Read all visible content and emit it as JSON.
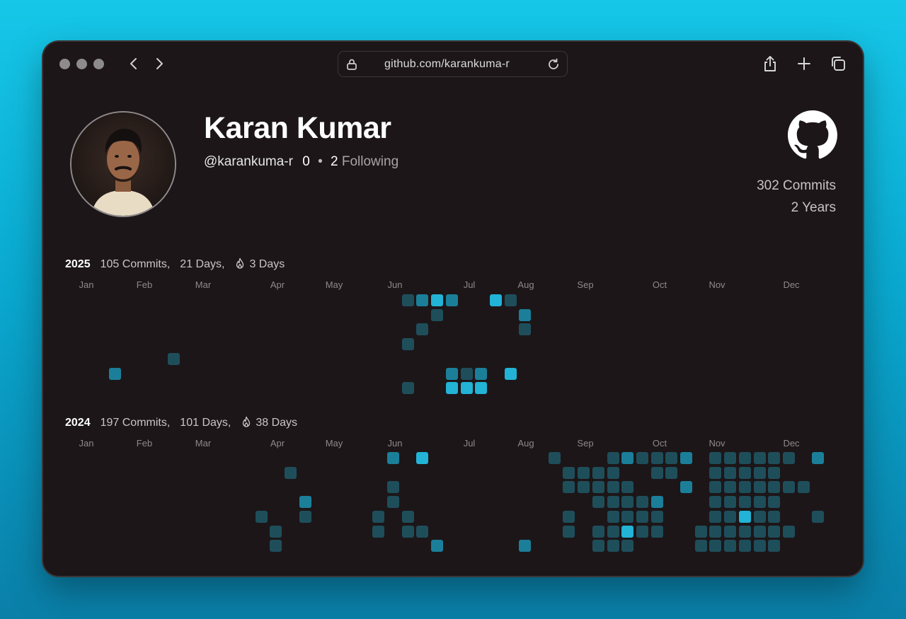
{
  "browser": {
    "url": "github.com/karankuma-r"
  },
  "profile": {
    "name": "Karan Kumar",
    "handle": "@karankuma-r",
    "followers": "0",
    "following_count": "2",
    "following_label": "Following",
    "total_commits": "302 Commits",
    "years": "2 Years"
  },
  "colors": {
    "background_top": "#16c7e8",
    "window": "#1c1618",
    "cell_low": "#1f4e5b",
    "cell_mid": "#1b7f9a",
    "cell_high": "#22b3d6"
  },
  "months": [
    "Jan",
    "Feb",
    "Mar",
    "Apr",
    "May",
    "Jun",
    "Jul",
    "Aug",
    "Sep",
    "Oct",
    "Nov",
    "Dec"
  ],
  "years": [
    {
      "year": "2025",
      "commits": "105 Commits,",
      "days": "21 Days,",
      "streak": "3 Days",
      "cells": [
        [
          21,
          0,
          1
        ],
        [
          22,
          0,
          2
        ],
        [
          23,
          0,
          3
        ],
        [
          24,
          0,
          2
        ],
        [
          27,
          0,
          3
        ],
        [
          28,
          0,
          1
        ],
        [
          23,
          1,
          1
        ],
        [
          29,
          1,
          2
        ],
        [
          22,
          2,
          1
        ],
        [
          29,
          2,
          1
        ],
        [
          21,
          3,
          1
        ],
        [
          5,
          4,
          1
        ],
        [
          1,
          5,
          2
        ],
        [
          24,
          5,
          2
        ],
        [
          25,
          5,
          1
        ],
        [
          26,
          5,
          2
        ],
        [
          28,
          5,
          3
        ],
        [
          21,
          6,
          1
        ],
        [
          24,
          6,
          3
        ],
        [
          25,
          6,
          3
        ],
        [
          26,
          6,
          3
        ]
      ]
    },
    {
      "year": "2024",
      "commits": "197 Commits,",
      "days": "101 Days,",
      "streak": "38 Days",
      "cells": [
        [
          20,
          0,
          2
        ],
        [
          22,
          0,
          3
        ],
        [
          31,
          0,
          1
        ],
        [
          35,
          0,
          1
        ],
        [
          36,
          0,
          2
        ],
        [
          37,
          0,
          1
        ],
        [
          38,
          0,
          1
        ],
        [
          39,
          0,
          1
        ],
        [
          40,
          0,
          2
        ],
        [
          42,
          0,
          1
        ],
        [
          43,
          0,
          1
        ],
        [
          44,
          0,
          1
        ],
        [
          45,
          0,
          1
        ],
        [
          46,
          0,
          1
        ],
        [
          47,
          0,
          1
        ],
        [
          49,
          0,
          2
        ],
        [
          13,
          1,
          1
        ],
        [
          32,
          1,
          1
        ],
        [
          33,
          1,
          1
        ],
        [
          34,
          1,
          1
        ],
        [
          35,
          1,
          1
        ],
        [
          38,
          1,
          1
        ],
        [
          39,
          1,
          1
        ],
        [
          42,
          1,
          1
        ],
        [
          43,
          1,
          1
        ],
        [
          44,
          1,
          1
        ],
        [
          45,
          1,
          1
        ],
        [
          46,
          1,
          1
        ],
        [
          20,
          2,
          1
        ],
        [
          32,
          2,
          1
        ],
        [
          33,
          2,
          1
        ],
        [
          34,
          2,
          1
        ],
        [
          35,
          2,
          1
        ],
        [
          36,
          2,
          1
        ],
        [
          40,
          2,
          2
        ],
        [
          42,
          2,
          1
        ],
        [
          43,
          2,
          1
        ],
        [
          44,
          2,
          1
        ],
        [
          45,
          2,
          1
        ],
        [
          46,
          2,
          1
        ],
        [
          47,
          2,
          1
        ],
        [
          48,
          2,
          1
        ],
        [
          14,
          3,
          2
        ],
        [
          20,
          3,
          1
        ],
        [
          34,
          3,
          1
        ],
        [
          35,
          3,
          1
        ],
        [
          36,
          3,
          1
        ],
        [
          37,
          3,
          1
        ],
        [
          38,
          3,
          2
        ],
        [
          42,
          3,
          1
        ],
        [
          43,
          3,
          1
        ],
        [
          44,
          3,
          1
        ],
        [
          45,
          3,
          1
        ],
        [
          46,
          3,
          1
        ],
        [
          11,
          4,
          1
        ],
        [
          14,
          4,
          1
        ],
        [
          19,
          4,
          1
        ],
        [
          21,
          4,
          1
        ],
        [
          32,
          4,
          1
        ],
        [
          35,
          4,
          1
        ],
        [
          36,
          4,
          1
        ],
        [
          37,
          4,
          1
        ],
        [
          38,
          4,
          1
        ],
        [
          42,
          4,
          1
        ],
        [
          43,
          4,
          1
        ],
        [
          44,
          4,
          3
        ],
        [
          45,
          4,
          1
        ],
        [
          46,
          4,
          1
        ],
        [
          49,
          4,
          1
        ],
        [
          12,
          5,
          1
        ],
        [
          19,
          5,
          1
        ],
        [
          21,
          5,
          1
        ],
        [
          22,
          5,
          1
        ],
        [
          32,
          5,
          1
        ],
        [
          34,
          5,
          1
        ],
        [
          35,
          5,
          1
        ],
        [
          36,
          5,
          3
        ],
        [
          37,
          5,
          1
        ],
        [
          38,
          5,
          1
        ],
        [
          41,
          5,
          1
        ],
        [
          42,
          5,
          1
        ],
        [
          43,
          5,
          1
        ],
        [
          44,
          5,
          1
        ],
        [
          45,
          5,
          1
        ],
        [
          46,
          5,
          1
        ],
        [
          47,
          5,
          1
        ],
        [
          12,
          6,
          1
        ],
        [
          23,
          6,
          2
        ],
        [
          29,
          6,
          2
        ],
        [
          34,
          6,
          1
        ],
        [
          35,
          6,
          1
        ],
        [
          36,
          6,
          1
        ],
        [
          41,
          6,
          1
        ],
        [
          42,
          6,
          1
        ],
        [
          43,
          6,
          1
        ],
        [
          44,
          6,
          1
        ],
        [
          45,
          6,
          1
        ],
        [
          46,
          6,
          1
        ]
      ]
    }
  ]
}
